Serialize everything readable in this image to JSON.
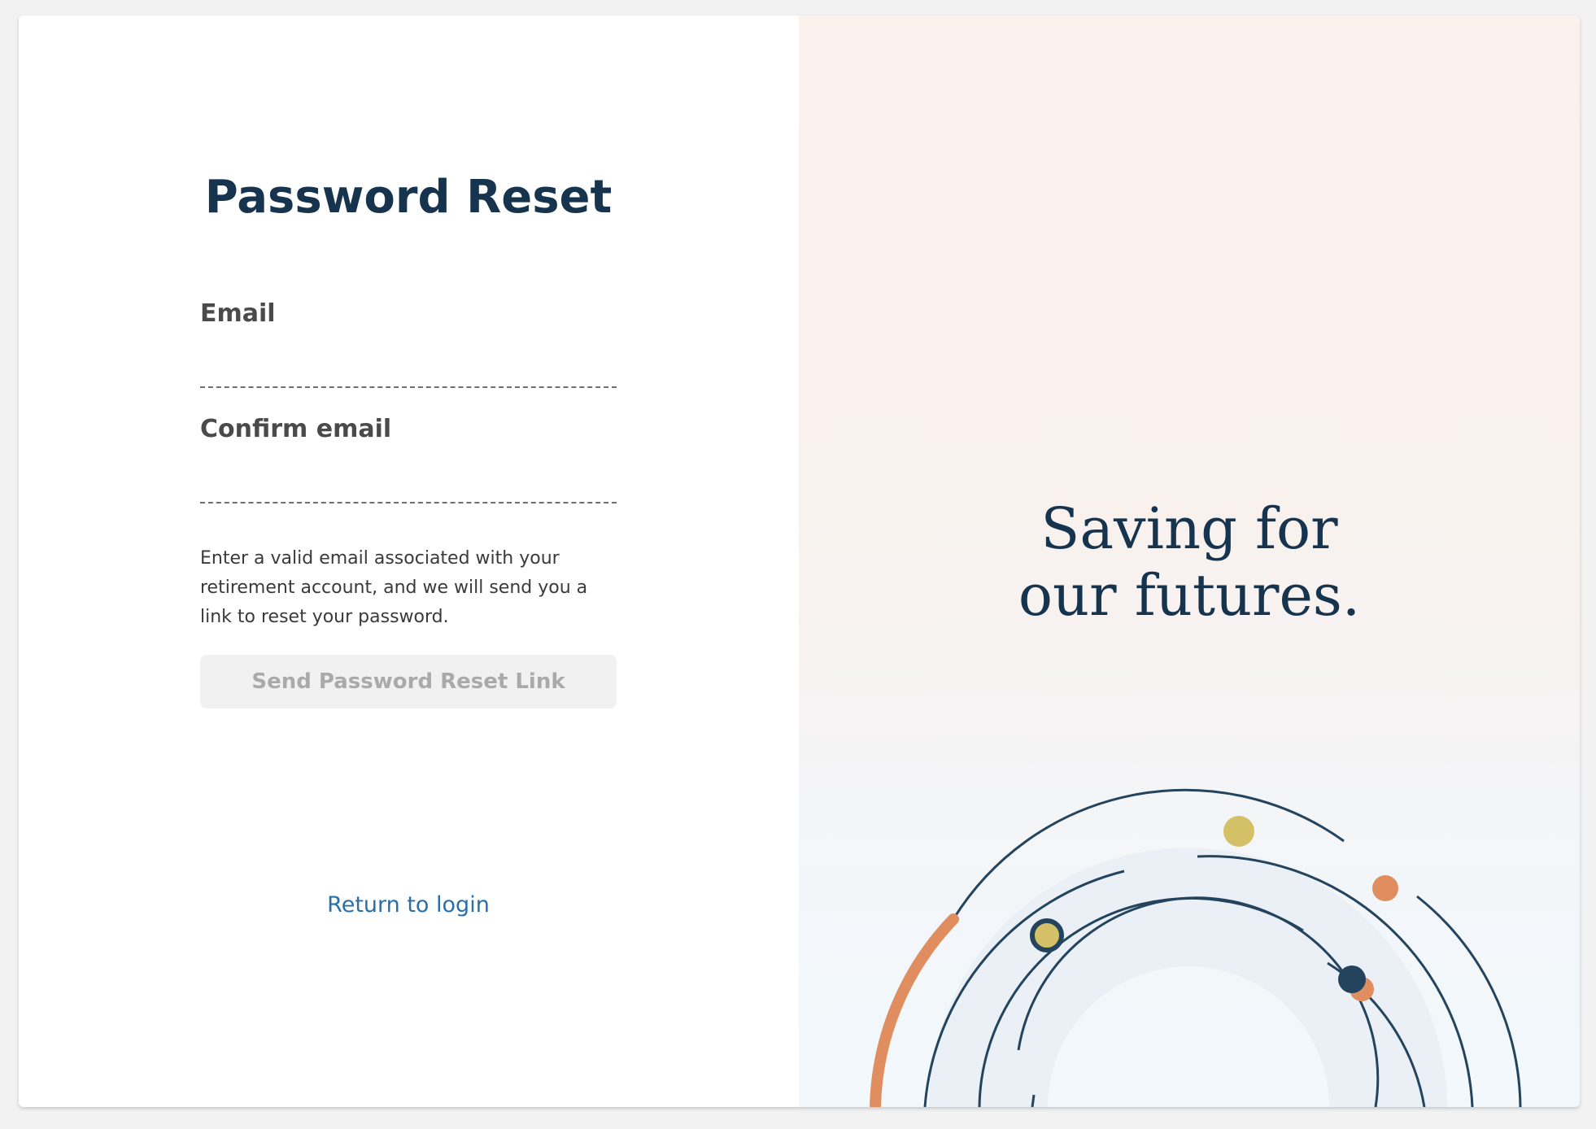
{
  "form": {
    "title": "Password Reset",
    "email_label": "Email",
    "email_value": "",
    "confirm_label": "Confirm email",
    "confirm_value": "",
    "help_text": "Enter a valid email associated with your retirement account, and we will send you a link to reset your password.",
    "submit_label": "Send Password Reset Link",
    "return_link": "Return to login"
  },
  "promo": {
    "tagline_line1": "Saving for",
    "tagline_line2": "our futures."
  },
  "colors": {
    "navy": "#17344f",
    "link_blue": "#2a6fa8",
    "orange": "#e08e5f",
    "gold": "#d4c167",
    "dark_node": "#24445e",
    "band_fill": "#eaf0f6"
  }
}
